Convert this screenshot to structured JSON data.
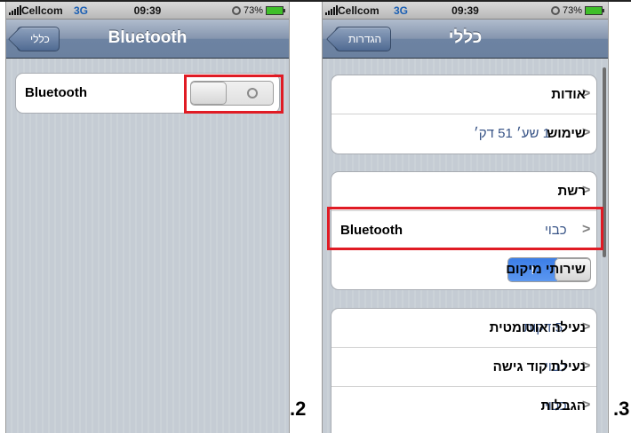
{
  "colors": {
    "highlight": "#e01b24",
    "nav_bar": "#7083a3",
    "toggle_on": "#3c7ee7",
    "value_text": "#385487"
  },
  "left_screen": {
    "status": {
      "carrier": "Cellcom",
      "network": "3G",
      "time": "09:39",
      "battery": "73%"
    },
    "nav": {
      "back_label": "כללי",
      "title": "Bluetooth"
    },
    "rows": [
      {
        "label": "Bluetooth",
        "toggle_state": "off"
      }
    ]
  },
  "right_screen": {
    "status": {
      "carrier": "Cellcom",
      "network": "3G",
      "time": "09:39",
      "battery": "73%"
    },
    "nav": {
      "back_label": "הגדרות",
      "title": "כללי"
    },
    "groups": [
      {
        "rows": [
          {
            "label": "אודות",
            "value": ""
          },
          {
            "label": "שימוש",
            "value": "1 שע׳ 51 דק׳"
          }
        ]
      },
      {
        "rows": [
          {
            "label": "רשת",
            "value": ""
          },
          {
            "label": "Bluetooth",
            "value": "כבוי"
          },
          {
            "label": "שירותי מיקום",
            "toggle_state": "on",
            "toggle_on_text": "I"
          }
        ]
      },
      {
        "rows": [
          {
            "label": "נעילה אוטומטית",
            "value": "5 דקות"
          },
          {
            "label": "נעילת קוד גישה",
            "value": "כבוי"
          },
          {
            "label": "הגבלות",
            "value": "כבוי"
          }
        ]
      }
    ]
  },
  "steps": {
    "left": ".2",
    "right": ".3"
  },
  "icons": [
    "signal-bars-icon",
    "alarm-clock-icon",
    "battery-icon",
    "chevron-right-icon",
    "back-arrow-icon"
  ]
}
